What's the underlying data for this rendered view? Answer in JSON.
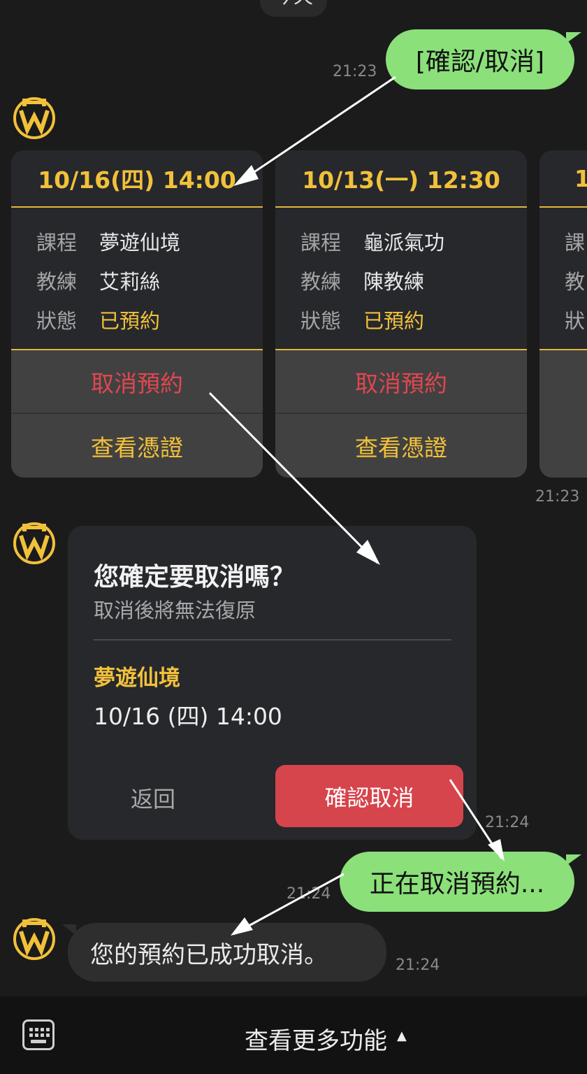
{
  "top": {
    "partial_text": "今天"
  },
  "messages": {
    "user_confirm_cancel": {
      "text": "[確認/取消]",
      "time": "21:23"
    },
    "carousel_time": "21:23",
    "dialog_time": "21:24",
    "user_cancelling": {
      "text": "正在取消預約...",
      "time": "21:24"
    },
    "bot_result": {
      "text": "您的預約已成功取消。",
      "time": "21:24"
    }
  },
  "cards": [
    {
      "datetime": "10/16(四) 14:00",
      "labels": {
        "course": "課程",
        "coach": "教練",
        "status": "狀態"
      },
      "course": "夢遊仙境",
      "coach": "艾莉絲",
      "status": "已預約",
      "cancel_label": "取消預約",
      "voucher_label": "查看憑證"
    },
    {
      "datetime": "10/13(一) 12:30",
      "labels": {
        "course": "課程",
        "coach": "教練",
        "status": "狀態"
      },
      "course": "龜派氣功",
      "coach": "陳教練",
      "status": "已預約",
      "cancel_label": "取消預約",
      "voucher_label": "查看憑證"
    },
    {
      "datetime": "1",
      "labels": {
        "course": "課",
        "coach": "教",
        "status": "狀"
      }
    }
  ],
  "dialog": {
    "title": "您確定要取消嗎？",
    "subtitle": "取消後將無法復原",
    "course": "夢遊仙境",
    "datetime": "10/16 (四) 14:00",
    "back_label": "返回",
    "confirm_label": "確認取消"
  },
  "bottombar": {
    "more_label": "查看更多功能",
    "caret": "▲"
  },
  "avatar": {
    "text": "WALLY STUDIO"
  },
  "colors": {
    "background": "#1b1b1b",
    "gold": "#f2c13a",
    "green_bubble": "#8be07a",
    "danger": "#d6444c",
    "card": "#26282c"
  }
}
